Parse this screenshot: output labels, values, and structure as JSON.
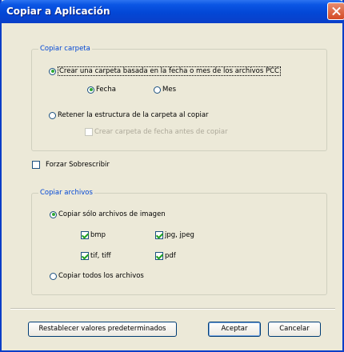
{
  "window": {
    "title": "Copiar a Aplicación"
  },
  "copy_folder": {
    "label": "Copiar carpeta",
    "option_create": "Crear una carpeta basada en la fecha o mes de los archivos PCC",
    "option_date": "Fecha",
    "option_month": "Mes",
    "option_retain": "Retener la estructura de la carpeta al copiar",
    "option_create_date_before": "Crear carpeta de fecha antes de copiar"
  },
  "force_overwrite": {
    "label": "Forzar Sobrescribir"
  },
  "copy_files": {
    "label": "Copiar archivos",
    "option_images_only": "Copiar sólo archivos de imagen",
    "types": {
      "bmp": "bmp",
      "jpg": "jpg, jpeg",
      "tif": "tif, tiff",
      "pdf": "pdf"
    },
    "option_all": "Copiar todos los archivos"
  },
  "buttons": {
    "restore": "Restablecer valores predeterminados",
    "accept": "Aceptar",
    "cancel": "Cancelar"
  }
}
